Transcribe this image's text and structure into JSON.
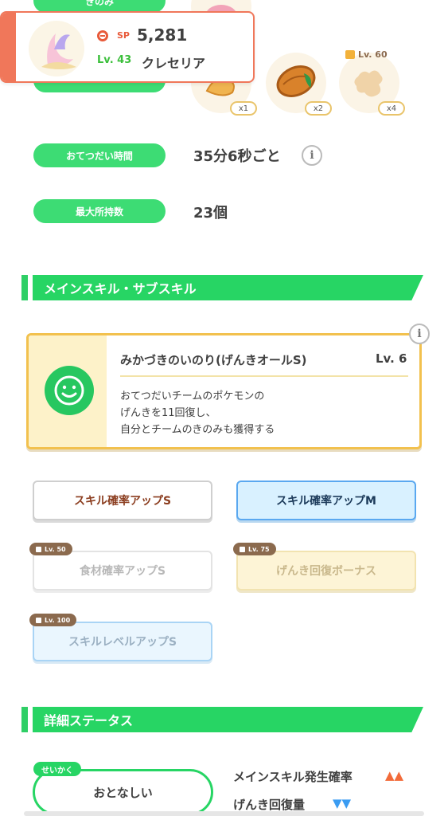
{
  "top_header_pill": "きのみ",
  "pokemon_card": {
    "sp_label": "SP",
    "sp_value": "5,281",
    "level": "Lv. 43",
    "name": "クレセリア"
  },
  "ingredients": [
    {
      "icon": "mushroom-icon",
      "qty": "x1"
    },
    {
      "icon": "cacao-icon",
      "qty": "x2"
    },
    {
      "icon": "ginger-icon",
      "qty": "x4",
      "lock_level": "Lv. 60"
    }
  ],
  "stats": {
    "help_time_label": "おてつだい時間",
    "help_time_value": "35分6秒ごと",
    "max_hold_label": "最大所持数",
    "max_hold_value": "23個"
  },
  "skills_section": {
    "title": "メインスキル・サブスキル",
    "main_skill_name": "みかづきのいのり(げんきオールS)",
    "main_skill_level": "Lv. 6",
    "main_skill_desc": [
      "おてつだいチームのポケモンの",
      "げんきを11回復し、",
      "自分とチームのきのみも獲得する"
    ]
  },
  "sub_skills": [
    {
      "label": "スキル確率アップS",
      "lock": ""
    },
    {
      "label": "スキル確率アップM",
      "lock": ""
    },
    {
      "label": "食材確率アップS",
      "lock": "Lv. 50"
    },
    {
      "label": "げんき回復ボーナス",
      "lock": "Lv. 75"
    },
    {
      "label": "スキルレベルアップS",
      "lock": "Lv. 100"
    }
  ],
  "details_section": {
    "title": "詳細ステータス",
    "nature_tag": "せいかく",
    "nature_value": "おとなしい",
    "up_stat": "メインスキル発生確率",
    "up_arrows": "▲▲",
    "down_stat": "げんき回復量",
    "down_arrows": "▼▼"
  },
  "colors": {
    "green": "#27d564",
    "orange_accent": "#f0775a",
    "gold_border": "#f2c14e",
    "blue_button": "#d9f1ff",
    "up": "#f26b3a",
    "down": "#3a9cf2"
  }
}
